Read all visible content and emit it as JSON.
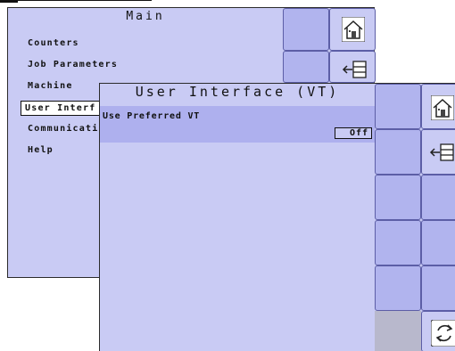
{
  "main_menu": {
    "title": "Main",
    "items": [
      {
        "label": "Counters"
      },
      {
        "label": "Job Parameters"
      },
      {
        "label": "Machine"
      },
      {
        "label": "User Interf"
      },
      {
        "label": "Communicati"
      },
      {
        "label": "Help"
      }
    ],
    "selected_index": 3
  },
  "user_interface": {
    "title": "User Interface (VT)",
    "settings": [
      {
        "label": "Use Preferred VT",
        "value": "Off"
      }
    ]
  },
  "icons": {
    "home": "home-icon",
    "exit": "exit-menu-icon",
    "refresh": "refresh-icon"
  },
  "colors": {
    "panel_background": "#c9cbf4",
    "highlight_row": "#aeb0ee",
    "button": "#b1b4ee",
    "disabled_area": "#b8b8cc"
  }
}
